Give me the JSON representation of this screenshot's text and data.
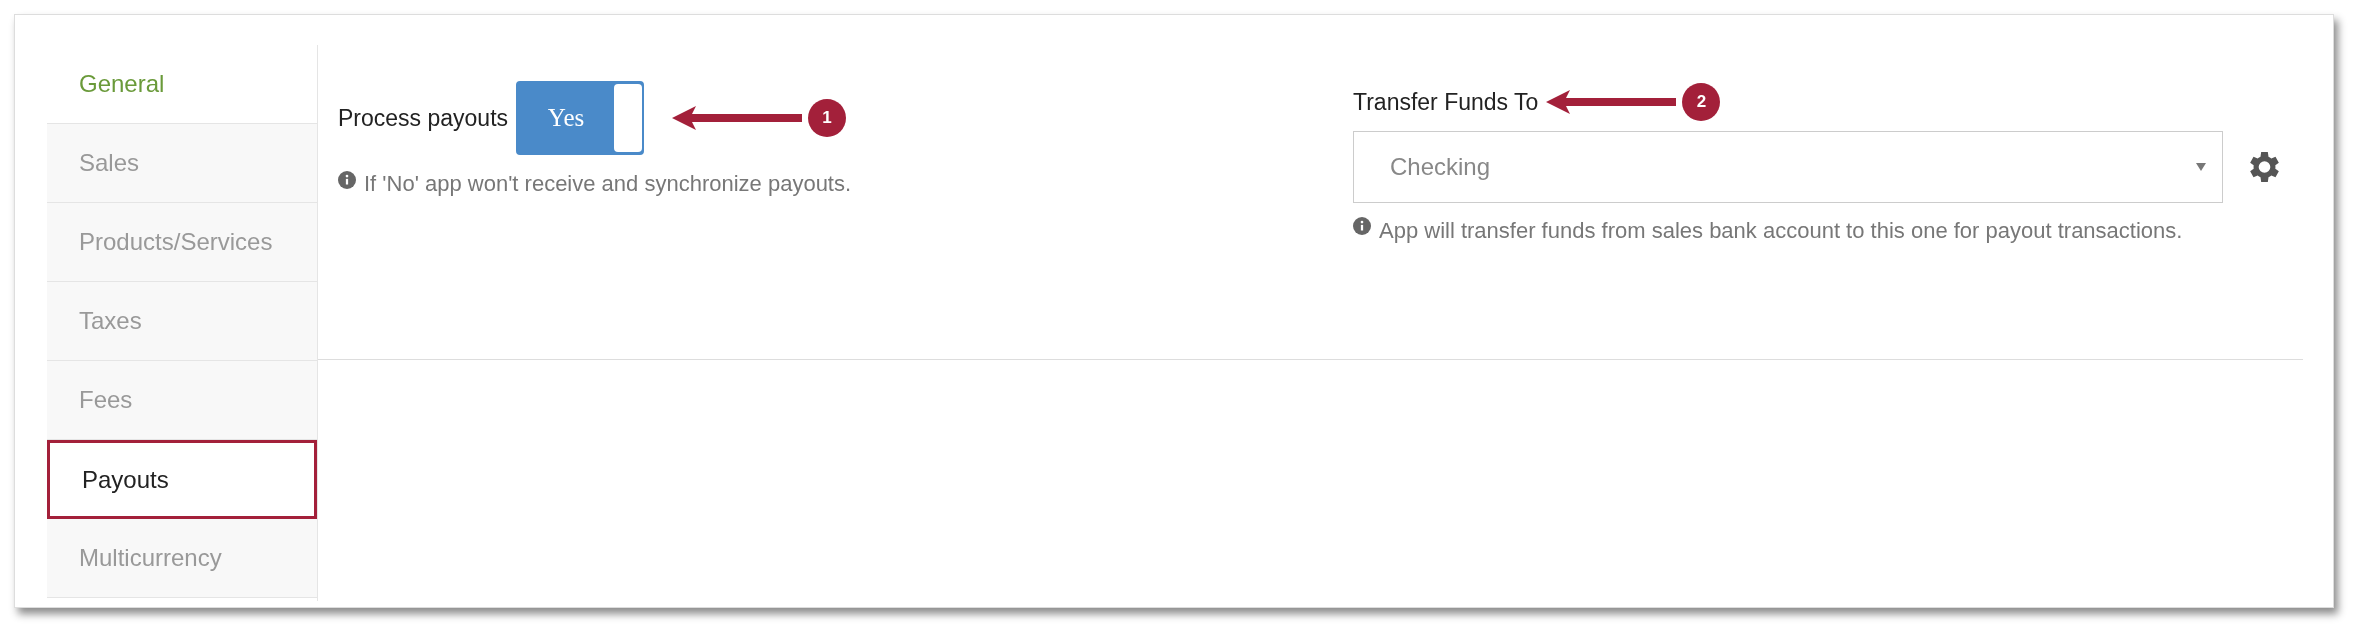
{
  "sidebar": {
    "items": [
      {
        "label": "General",
        "selected": false,
        "highlighted": true
      },
      {
        "label": "Sales",
        "selected": false,
        "highlighted": false
      },
      {
        "label": "Products/Services",
        "selected": false,
        "highlighted": false
      },
      {
        "label": "Taxes",
        "selected": false,
        "highlighted": false
      },
      {
        "label": "Fees",
        "selected": false,
        "highlighted": false
      },
      {
        "label": "Payouts",
        "selected": true,
        "highlighted": false
      },
      {
        "label": "Multicurrency",
        "selected": false,
        "highlighted": false
      }
    ]
  },
  "process_payouts": {
    "label": "Process payouts",
    "toggle": {
      "on": true,
      "text": "Yes"
    },
    "help": "If 'No' app won't receive and synchronize payouts.",
    "callout": "1"
  },
  "transfer_funds": {
    "label": "Transfer Funds To",
    "value": "Checking",
    "help": "App will transfer funds from sales bank account to this one for payout transactions.",
    "callout": "2"
  }
}
